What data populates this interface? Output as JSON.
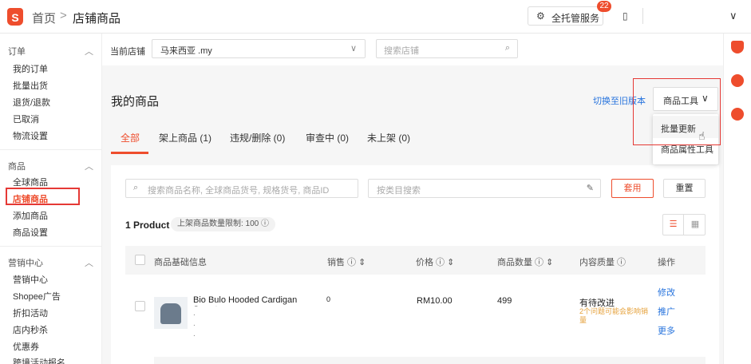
{
  "topbar": {
    "logo": "S",
    "home": "首页",
    "separator": ">",
    "current": "店铺商品",
    "service_label": "全托管服务",
    "service_badge": "22"
  },
  "sidebar": {
    "sections": [
      {
        "title": "订单",
        "items": [
          "我的订单",
          "批量出货",
          "退货/退款",
          "已取消",
          "物流设置"
        ]
      },
      {
        "title": "商品",
        "items": [
          "全球商品",
          "店铺商品",
          "添加商品",
          "商品设置"
        ]
      },
      {
        "title": "营销中心",
        "items": [
          "营销中心",
          "Shopee广告",
          "折扣活动",
          "店内秒杀",
          "优惠券",
          "跨境活动报名"
        ]
      }
    ],
    "active_item": "店铺商品"
  },
  "filter": {
    "shop_label": "当前店铺",
    "shop_value": "马来西亚                  .my",
    "shop_search_placeholder": "搜索店铺"
  },
  "main": {
    "title": "我的商品",
    "switch_old": "切换至旧版本",
    "tools_label": "商品工具",
    "tabs": [
      {
        "label": "全部",
        "active": true
      },
      {
        "label": "架上商品 (1)",
        "active": false
      },
      {
        "label": "违规/删除 (0)",
        "active": false
      },
      {
        "label": "审查中 (0)",
        "active": false
      },
      {
        "label": "未上架 (0)",
        "active": false
      }
    ]
  },
  "dropdown": {
    "items": [
      "批量更新",
      "商品属性工具"
    ],
    "hovered": "批量更新"
  },
  "search": {
    "keyword_placeholder": "搜索商品名称, 全球商品货号, 规格货号, 商品ID",
    "category_placeholder": "按类目搜索",
    "apply": "套用",
    "reset": "重置"
  },
  "list": {
    "count": "1 Product",
    "limit": "上架商品数量限制: 100",
    "columns": [
      "商品基础信息",
      "销售",
      "价格",
      "商品数量",
      "内容质量",
      "操作"
    ],
    "rows": [
      {
        "name": "Bio Bulo Hooded Cardigan Sweater",
        "sales": "0",
        "price": "RM10.00",
        "stock": "499",
        "quality": "有待改进",
        "quality_note": "2个问题可能会影响销量",
        "actions": [
          "修改",
          "推广",
          "更多"
        ]
      }
    ]
  },
  "colors": {
    "brand": "#ee4d2d",
    "link": "#2673dd",
    "warn": "#e6a23c",
    "highlight": "#e53935"
  }
}
